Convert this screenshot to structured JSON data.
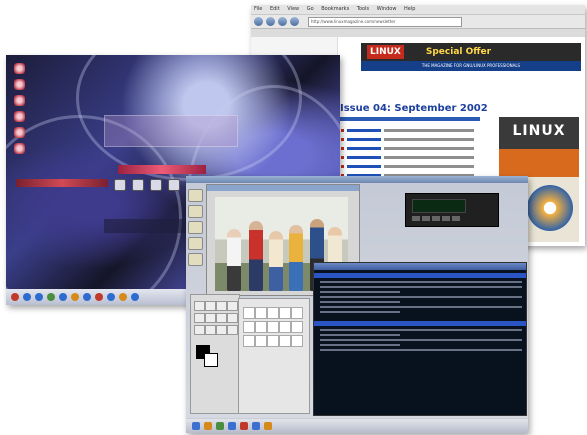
{
  "browser": {
    "menu": [
      "File",
      "Edit",
      "View",
      "Go",
      "Bookmarks",
      "Tools",
      "Window",
      "Help"
    ],
    "url": "http://www.linuxmagazine.com/newsletter",
    "banner_logo": "LINUX",
    "banner_offer": "Special Offer",
    "subbanner": "THE MAGAZINE FOR GNU/LINUX PROFESSIONALS",
    "issue_title": "Issue 04: September 2002",
    "magazine_title": "LINUX"
  },
  "desktop": {
    "theme": "dark-purple-swirl",
    "accent": "#3a3f8a"
  },
  "gimp": {
    "window": "image-window",
    "terminal_theme": "dark"
  }
}
